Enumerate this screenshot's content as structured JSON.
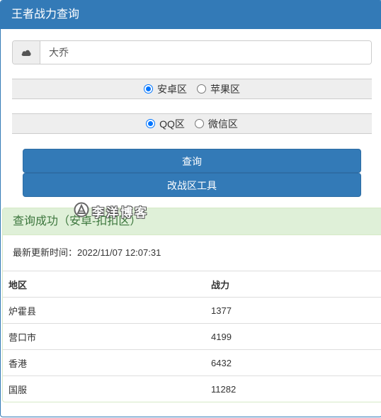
{
  "header": {
    "title": "王者战力查询"
  },
  "search": {
    "icon": "cloud-icon",
    "value": "大乔",
    "placeholder": ""
  },
  "platform": {
    "options": [
      {
        "label": "安卓区",
        "checked": true
      },
      {
        "label": "苹果区",
        "checked": false
      }
    ]
  },
  "account": {
    "options": [
      {
        "label": "QQ区",
        "checked": true
      },
      {
        "label": "微信区",
        "checked": false
      }
    ]
  },
  "buttons": {
    "query": "查询",
    "change_zone": "改战区工具"
  },
  "result": {
    "title": "查询成功（安卓-扣扣区）",
    "update_time": "最新更新时间：2022/11/07 12:07:31",
    "columns": [
      "地区",
      "战力"
    ],
    "rows": [
      {
        "region": "炉霍县",
        "power": "1377"
      },
      {
        "region": "营口市",
        "power": "4199"
      },
      {
        "region": "香港",
        "power": "6432"
      },
      {
        "region": "国服",
        "power": "11282"
      }
    ]
  },
  "watermark": {
    "text": "李洋博客"
  },
  "colors": {
    "primary": "#337ab7",
    "success_bg": "#dff0d8",
    "success_text": "#3c763d"
  }
}
